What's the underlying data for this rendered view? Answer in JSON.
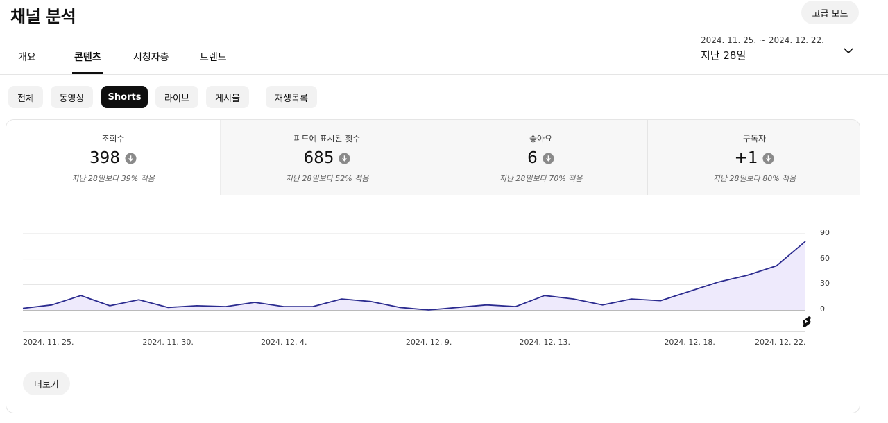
{
  "header": {
    "title": "채널 분석",
    "advanced_mode_label": "고급 모드",
    "date_range": "2024. 11. 25. ~ 2024. 12. 22.",
    "period_label": "지난 28일"
  },
  "tabs": [
    {
      "label": "개요",
      "active": false
    },
    {
      "label": "콘텐츠",
      "active": true
    },
    {
      "label": "시청자층",
      "active": false
    },
    {
      "label": "트렌드",
      "active": false
    }
  ],
  "chips": [
    {
      "label": "전체",
      "active": false
    },
    {
      "label": "동영상",
      "active": false
    },
    {
      "label": "Shorts",
      "active": true
    },
    {
      "label": "라이브",
      "active": false
    },
    {
      "label": "게시물",
      "active": false
    },
    {
      "label": "재생목록",
      "active": false
    }
  ],
  "metrics": [
    {
      "label": "조회수",
      "value": "398",
      "compare": "지난 28일보다 39% 적음",
      "trend_icon": "arrow-down-circle-icon",
      "active": true
    },
    {
      "label": "피드에 표시된 횟수",
      "value": "685",
      "compare": "지난 28일보다 52% 적음",
      "trend_icon": "arrow-down-circle-icon",
      "active": false
    },
    {
      "label": "좋아요",
      "value": "6",
      "compare": "지난 28일보다 70% 적음",
      "trend_icon": "arrow-down-circle-icon",
      "active": false
    },
    {
      "label": "구독자",
      "value": "+1",
      "compare": "지난 28일보다 80% 적음",
      "trend_icon": "arrow-down-circle-icon",
      "active": false
    }
  ],
  "more_label": "더보기",
  "colors": {
    "line": "#2b2b8f",
    "fill": "#eeeafc",
    "active_chip_bg": "#0f0f0f",
    "trend_icon": "#8a8a8a"
  },
  "chart_data": {
    "type": "area",
    "x": [
      "2024-11-25",
      "2024-11-26",
      "2024-11-27",
      "2024-11-28",
      "2024-11-29",
      "2024-11-30",
      "2024-12-01",
      "2024-12-02",
      "2024-12-03",
      "2024-12-04",
      "2024-12-05",
      "2024-12-06",
      "2024-12-07",
      "2024-12-08",
      "2024-12-09",
      "2024-12-10",
      "2024-12-11",
      "2024-12-12",
      "2024-12-13",
      "2024-12-14",
      "2024-12-15",
      "2024-12-16",
      "2024-12-17",
      "2024-12-18",
      "2024-12-19",
      "2024-12-20",
      "2024-12-21",
      "2024-12-22"
    ],
    "series": [
      {
        "values": [
          2,
          6,
          17,
          5,
          12,
          3,
          5,
          4,
          9,
          4,
          4,
          13,
          10,
          3,
          0,
          3,
          6,
          4,
          17,
          13,
          6,
          13,
          11,
          22,
          33,
          41,
          52,
          81
        ]
      }
    ],
    "x_tick_labels": [
      "2024. 11. 25.",
      "2024. 11. 30.",
      "2024. 12. 4.",
      "2024. 12. 9.",
      "2024. 12. 13.",
      "2024. 12. 18.",
      "2024. 12. 22."
    ],
    "y_ticks": [
      0,
      30,
      60,
      90
    ],
    "ylim": [
      0,
      90
    ],
    "grid": true,
    "y_axis_side": "right"
  }
}
